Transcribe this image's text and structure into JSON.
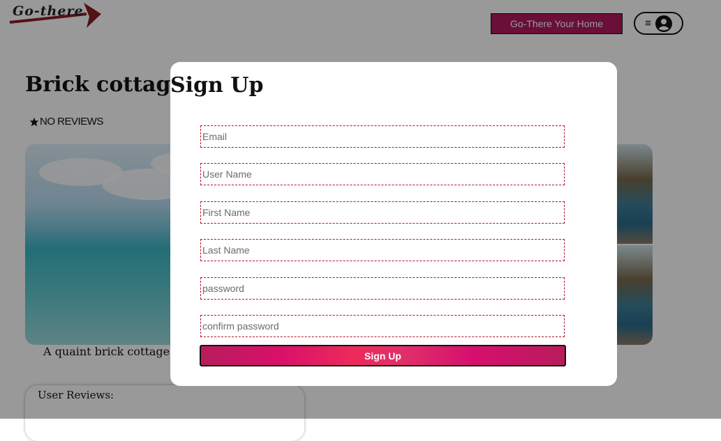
{
  "header": {
    "logo_text": "Go-there",
    "host_button": "Go-There Your Home",
    "profile_menu_icon": "≡"
  },
  "listing": {
    "title": "Brick cottage",
    "reviews_summary": "NO REVIEWS",
    "description": "A quaint brick cottage.",
    "user_reviews_heading": "User Reviews:"
  },
  "signup_modal": {
    "title": "Sign Up",
    "fields": {
      "email": "Email",
      "username": "User Name",
      "first_name": "First Name",
      "last_name": "Last Name",
      "password": "password",
      "confirm_password": "confirm password"
    },
    "submit_label": "Sign Up"
  },
  "colors": {
    "brand": "#b0195e",
    "field_border": "#b3122a",
    "overlay": "rgba(0,0,0,0.40)"
  },
  "icons": [
    "arrow-logo-icon",
    "hamburger-icon",
    "user-avatar-icon",
    "star-icon"
  ]
}
